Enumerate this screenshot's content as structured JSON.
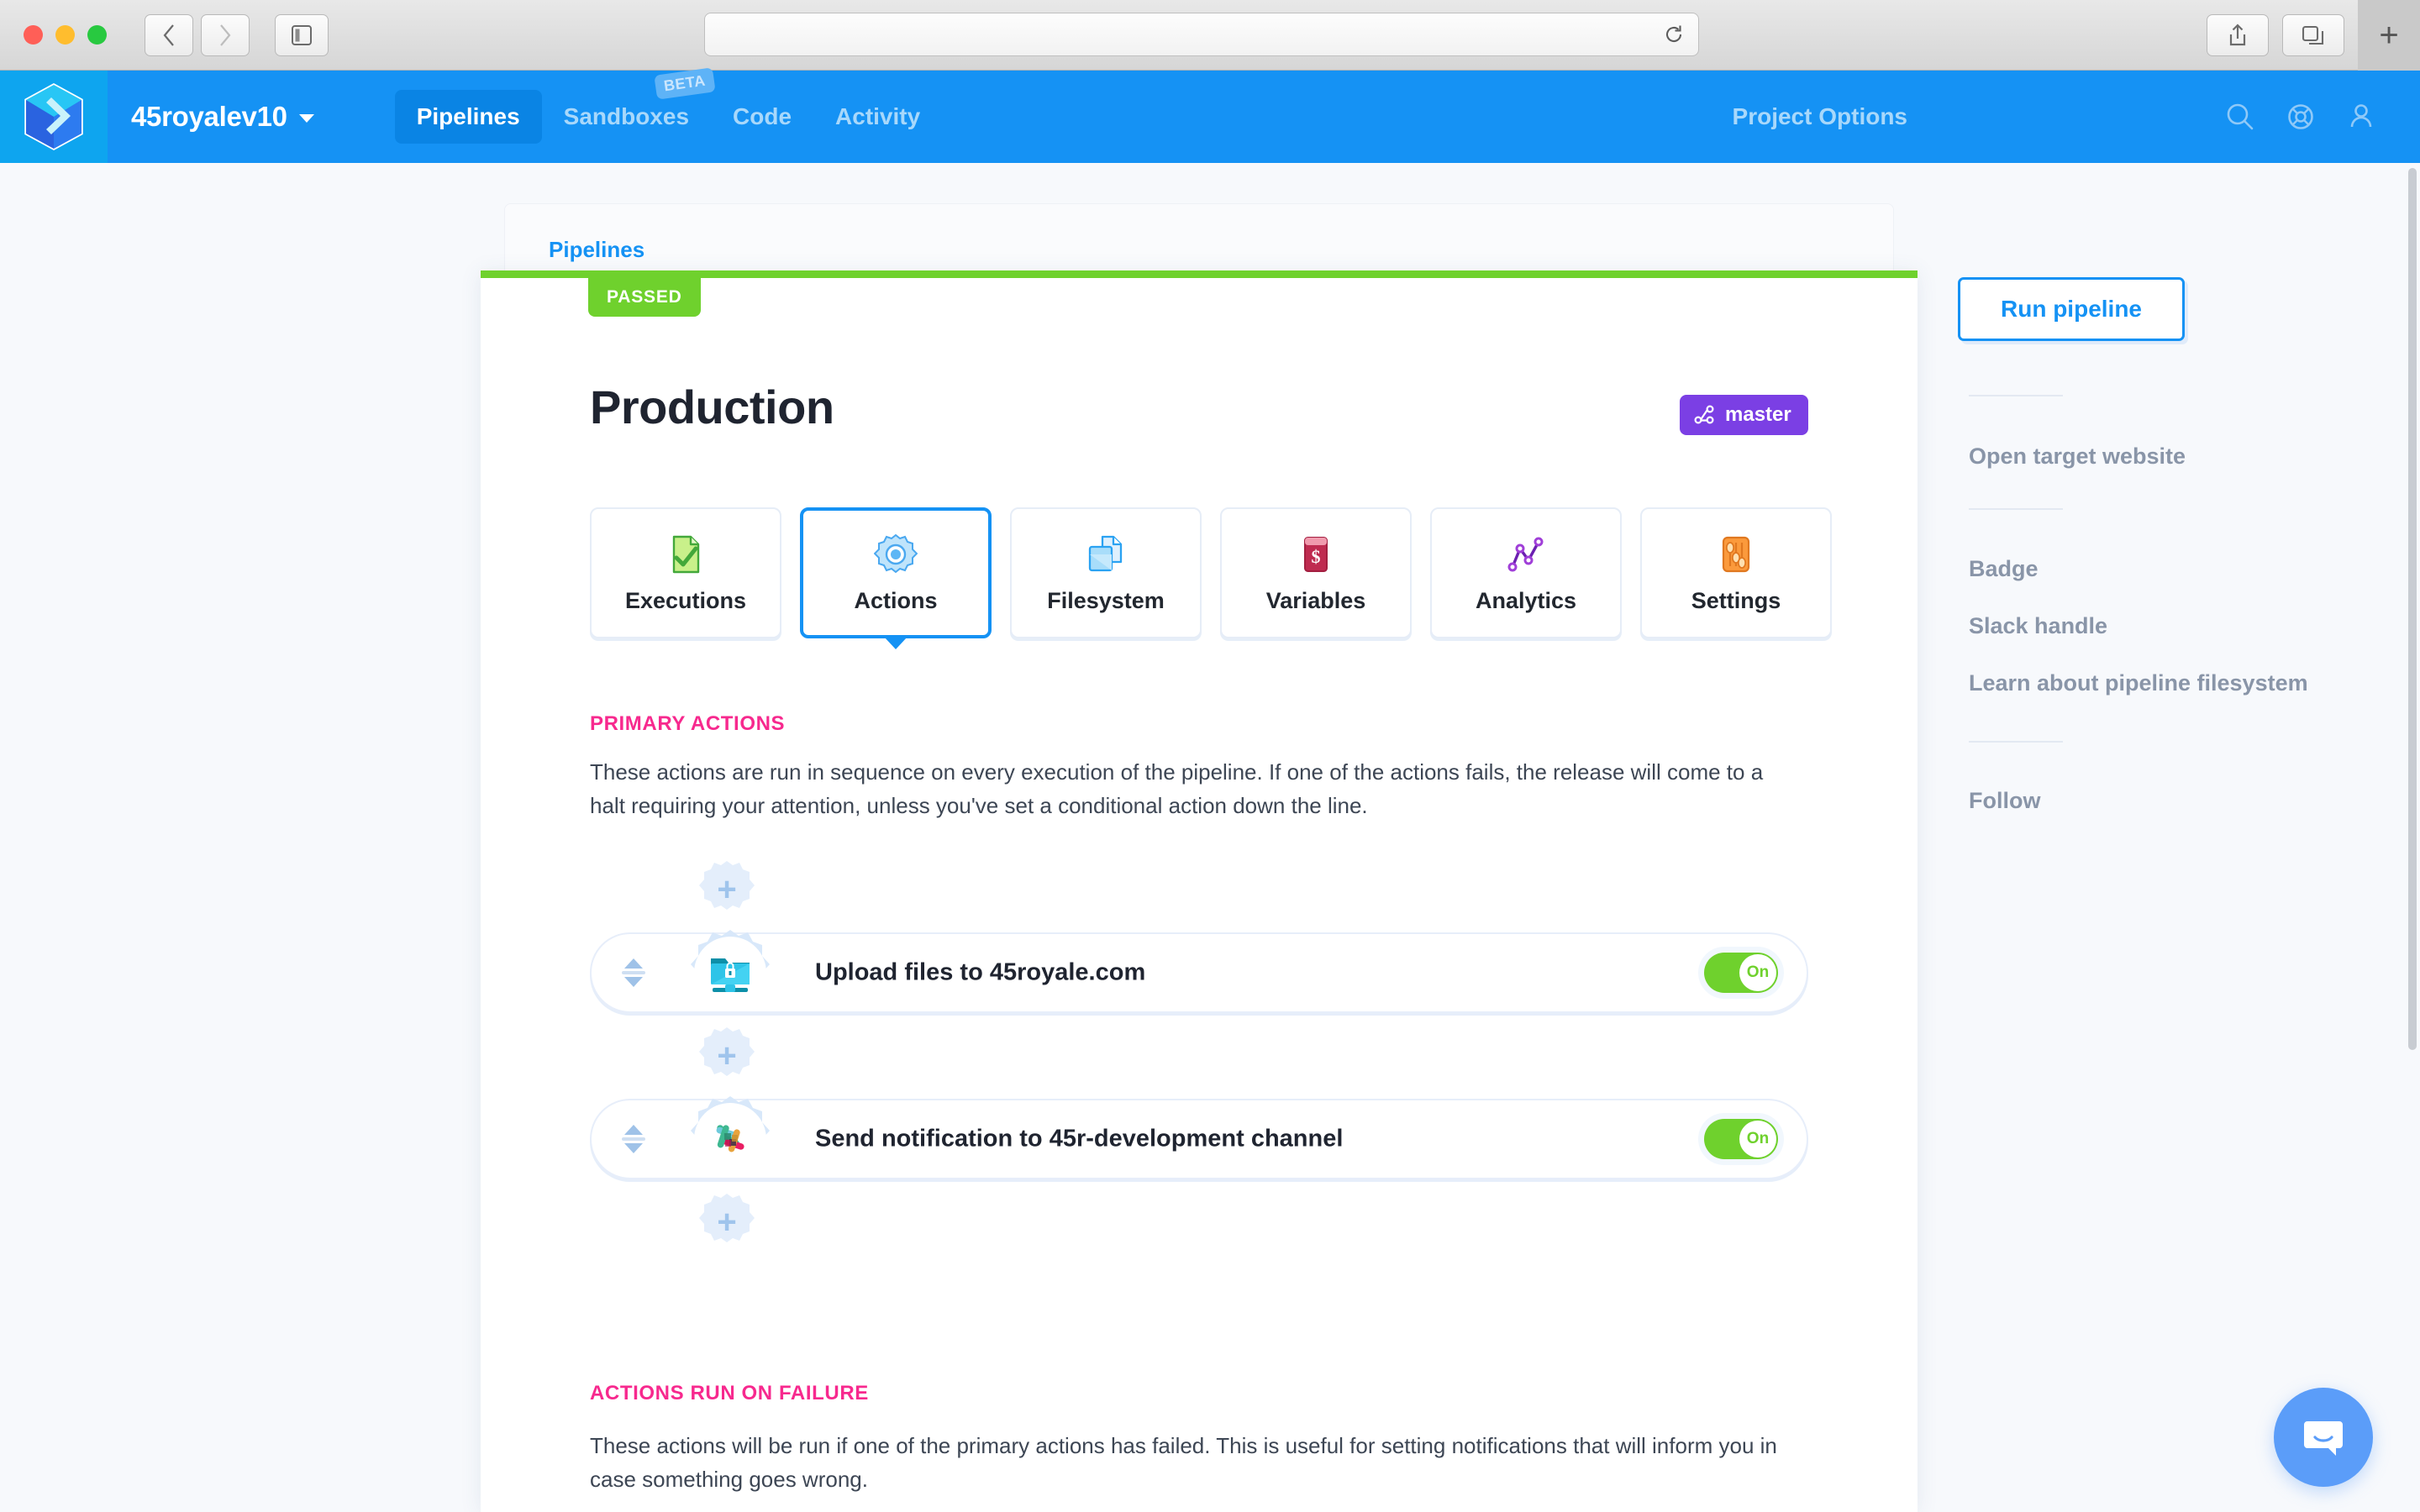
{
  "browser": {
    "url_value": "",
    "url_placeholder": "",
    "back_icon": "chevron-left-icon",
    "forward_icon": "chevron-right-icon",
    "sidebar_icon": "sidebar-toggle-icon",
    "reload_icon": "reload-icon",
    "share_icon": "share-icon",
    "tabs_icon": "tab-overview-icon",
    "newtab_label": "+"
  },
  "header": {
    "logo_name": "buddy-logo",
    "project_name": "45royalev10",
    "nav": [
      {
        "label": "Pipelines",
        "active": true,
        "badge": ""
      },
      {
        "label": "Sandboxes",
        "active": false,
        "badge": "BETA"
      },
      {
        "label": "Code",
        "active": false,
        "badge": ""
      },
      {
        "label": "Activity",
        "active": false,
        "badge": ""
      }
    ],
    "project_options": "Project Options",
    "icons": [
      "search-icon",
      "lifebuoy-icon",
      "user-icon"
    ]
  },
  "breadcrumb": {
    "label": "Pipelines"
  },
  "pipeline": {
    "status": "PASSED",
    "status_color": "#6fd12d",
    "title": "Production",
    "branch": "master",
    "branch_color": "#7b3fe4"
  },
  "tabs": [
    {
      "label": "Executions",
      "icon": "document-check-icon",
      "active": false
    },
    {
      "label": "Actions",
      "icon": "gear-icon",
      "active": true
    },
    {
      "label": "Filesystem",
      "icon": "files-icon",
      "active": false
    },
    {
      "label": "Variables",
      "icon": "dollar-card-icon",
      "active": false
    },
    {
      "label": "Analytics",
      "icon": "line-chart-icon",
      "active": false
    },
    {
      "label": "Settings",
      "icon": "sliders-icon",
      "active": false
    }
  ],
  "primary_section": {
    "heading": "PRIMARY ACTIONS",
    "description": "These actions are run in sequence on every execution of the pipeline. If one of the actions fails, the release will come to a halt requiring your attention, unless you've set a conditional action down the line."
  },
  "actions": [
    {
      "title": "Upload files to 45royale.com",
      "icon": "sftp-folder-lock-icon",
      "toggle_label": "On",
      "toggle_on": true
    },
    {
      "title": "Send notification to 45r-development channel",
      "icon": "slack-icon",
      "toggle_label": "On",
      "toggle_on": true
    }
  ],
  "failure_section": {
    "heading": "ACTIONS RUN ON FAILURE",
    "description": "These actions will be run if one of the primary actions has failed. This is useful for setting notifications that will inform you in case something goes wrong."
  },
  "sidebar": {
    "run_button": "Run pipeline",
    "links": [
      "Open target website",
      "Badge",
      "Slack handle",
      "Learn about pipeline filesystem",
      "Follow"
    ]
  },
  "intercom": {
    "icon": "chat-bubble-icon"
  },
  "colors": {
    "brand_blue": "#1592f4",
    "accent_pink": "#f7298e",
    "success_green": "#6fd12d",
    "branch_purple": "#7b3fe4"
  }
}
